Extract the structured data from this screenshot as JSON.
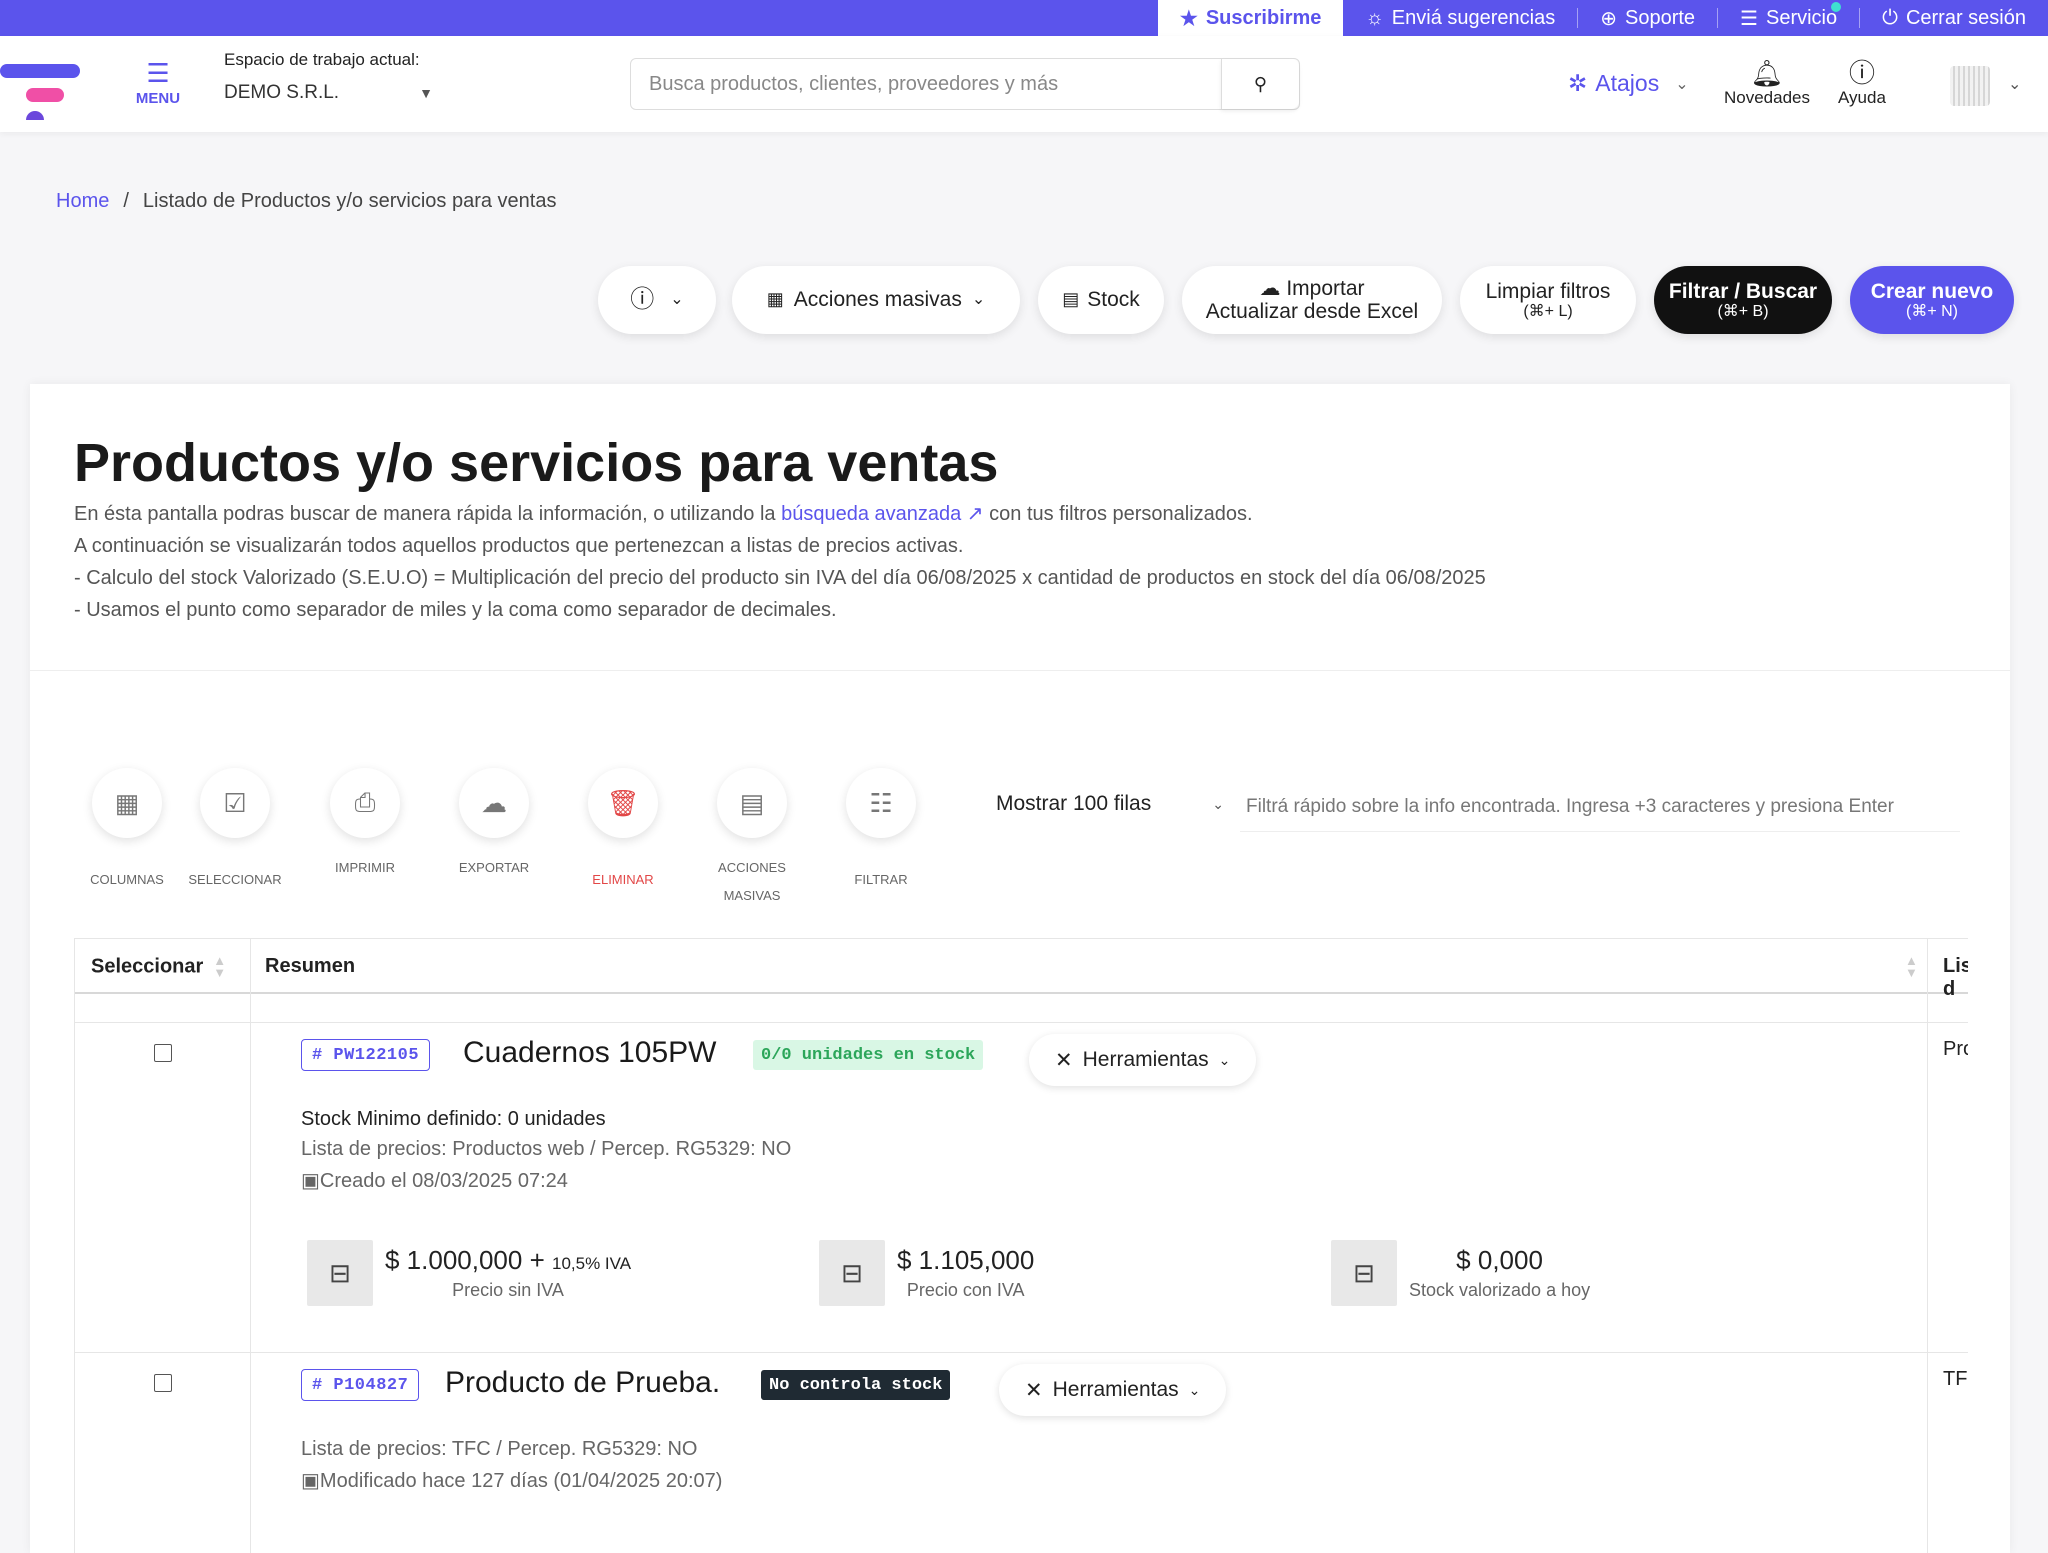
{
  "topbar": {
    "subscribe": "Suscribirme",
    "suggestions": "Enviá sugerencias",
    "support": "Soporte",
    "service": "Servicio",
    "logout": "Cerrar sesión"
  },
  "header": {
    "menu_label": "MENU",
    "workspace_label": "Espacio de trabajo actual:",
    "workspace_value": "DEMO S.R.L.",
    "search_placeholder": "Busca productos, clientes, proveedores y más",
    "shortcuts": "Atajos",
    "news": "Novedades",
    "help": "Ayuda"
  },
  "breadcrumb": {
    "home": "Home",
    "separator": "/",
    "current": "Listado de Productos y/o servicios para ventas"
  },
  "toolbar": {
    "bulk_actions": "Acciones masivas",
    "stock": "Stock",
    "import_line1": "Importar",
    "import_line2": "Actualizar desde Excel",
    "clear_filters": "Limpiar filtros",
    "clear_filters_shortcut": "(⌘+ L)",
    "filter_search": "Filtrar / Buscar",
    "filter_search_shortcut": "(⌘+ B)",
    "create_new": "Crear nuevo",
    "create_new_shortcut": "(⌘+ N)"
  },
  "page": {
    "title": "Productos y/o servicios para ventas",
    "desc1_pre": "En ésta pantalla podras buscar de manera rápida la información, o utilizando la ",
    "desc1_link": "búsqueda avanzada ↗",
    "desc1_post": " con tus filtros personalizados.",
    "desc2": "A continuación se visualizarán todos aquellos productos que pertenezcan a listas de precios activas.",
    "desc3": "- Calculo del stock Valorizado (S.E.U.O) = Multiplicación del precio del producto sin IVA del día 06/08/2025 x cantidad de productos en stock del día 06/08/2025",
    "desc4": "- Usamos el punto como separador de miles y la coma como separador de decimales."
  },
  "actions": {
    "columns": "COLUMNAS",
    "select": "SELECCIONAR",
    "print": "IMPRIMIR",
    "export": "EXPORTAR",
    "delete": "ELIMINAR",
    "bulk_line1": "ACCIONES",
    "bulk_line2": "MASIVAS",
    "filter": "FILTRAR"
  },
  "rows_select": "Mostrar 100 filas",
  "quick_filter_placeholder": "Filtrá rápido sobre la info encontrada. Ingresa +3 caracteres y presiona Enter",
  "table": {
    "headers": {
      "select": "Seleccionar",
      "summary": "Resumen",
      "list": "Lista d"
    },
    "rows": [
      {
        "code": "# PW122105",
        "name": "Cuadernos 105PW",
        "stock_badge": "0/0 unidades en stock",
        "tools": "Herramientas",
        "stock_min": "Stock Minimo definido: 0 unidades",
        "price_list": "Lista de precios: Productos web / Percep. RG5329: NO",
        "date": "Creado el 08/03/2025 07:24",
        "price_no_iva": "$ 1.000,000 +",
        "iva": "10,5% IVA",
        "price_no_iva_label": "Precio sin IVA",
        "price_iva": "$ 1.105,000",
        "price_iva_label": "Precio con IVA",
        "stock_value": "$ 0,000",
        "stock_value_label": "Stock valorizado a hoy",
        "list": "Produ"
      },
      {
        "code": "# P104827",
        "name": "Producto de Prueba.",
        "stock_badge": "No controla stock",
        "tools": "Herramientas",
        "price_list": "Lista de precios: TFC / Percep. RG5329: NO",
        "date": "Modificado hace 127 días (01/04/2025 20:07)",
        "list": "TFC"
      }
    ]
  },
  "colors": {
    "primary": "#5b54ec",
    "danger": "#e24747",
    "success": "#2ca65a"
  }
}
